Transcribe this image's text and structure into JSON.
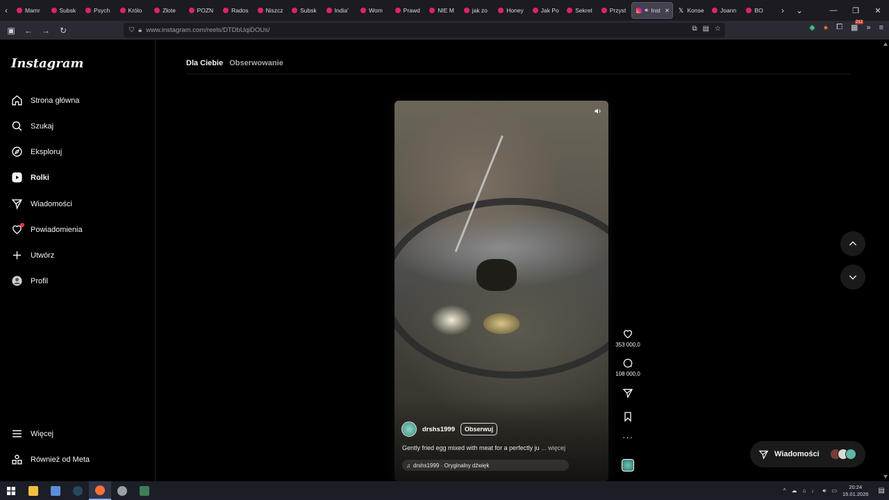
{
  "browser": {
    "tabs": [
      {
        "label": "Mamr",
        "type": "yt"
      },
      {
        "label": "Subsk",
        "type": "yt"
      },
      {
        "label": "Psych",
        "type": "yt"
      },
      {
        "label": "Królo",
        "type": "yt"
      },
      {
        "label": "Złote",
        "type": "yt"
      },
      {
        "label": "POZN",
        "type": "yt"
      },
      {
        "label": "Rados",
        "type": "yt"
      },
      {
        "label": "Niszcz",
        "type": "yt"
      },
      {
        "label": "Subsk",
        "type": "yt"
      },
      {
        "label": "India'",
        "type": "yt"
      },
      {
        "label": "Wom",
        "type": "yt"
      },
      {
        "label": "Prawd",
        "type": "yt"
      },
      {
        "label": "NIE M",
        "type": "yt"
      },
      {
        "label": "jak zo",
        "type": "yt"
      },
      {
        "label": "Honey",
        "type": "yt"
      },
      {
        "label": "Jak Po",
        "type": "yt"
      },
      {
        "label": "Sekret",
        "type": "yt"
      },
      {
        "label": "Przyst",
        "type": "yt"
      },
      {
        "label": "Inst",
        "type": "ig",
        "active": true
      },
      {
        "label": "Konse",
        "type": "x"
      },
      {
        "label": "Joann",
        "type": "yt"
      },
      {
        "label": "BO",
        "type": "yt"
      }
    ],
    "url": "www.instagram.com/reels/DTDbUqiDOUs/",
    "extension_badge": "212"
  },
  "instagram": {
    "logo": "Instagram",
    "nav": [
      {
        "label": "Strona główna",
        "icon": "home-icon"
      },
      {
        "label": "Szukaj",
        "icon": "search-icon"
      },
      {
        "label": "Eksploruj",
        "icon": "compass-icon"
      },
      {
        "label": "Rolki",
        "icon": "reels-icon",
        "active": true
      },
      {
        "label": "Wiadomości",
        "icon": "messages-icon"
      },
      {
        "label": "Powiadomienia",
        "icon": "heart-icon"
      },
      {
        "label": "Utwórz",
        "icon": "plus-icon"
      },
      {
        "label": "Profil",
        "icon": "profile-icon"
      }
    ],
    "more": "Więcej",
    "meta": "Również od Meta",
    "tabs": {
      "for_you": "Dla Ciebie",
      "following": "Obserwowanie"
    },
    "reel": {
      "username": "drshs1999",
      "follow": "Obserwuj",
      "caption": "Gently fried egg mixed with meat for a perfectly ju",
      "more": "... więcej",
      "audio": "drshs1999 · Oryginalny dźwięk",
      "likes": "353 000,0",
      "comments": "108 000,0"
    },
    "messages_pill": "Wiadomości"
  },
  "taskbar": {
    "time": "20:24",
    "date": "15.01.2026"
  },
  "colors": {
    "accent_notification": "#ff3040",
    "background": "#000000"
  }
}
